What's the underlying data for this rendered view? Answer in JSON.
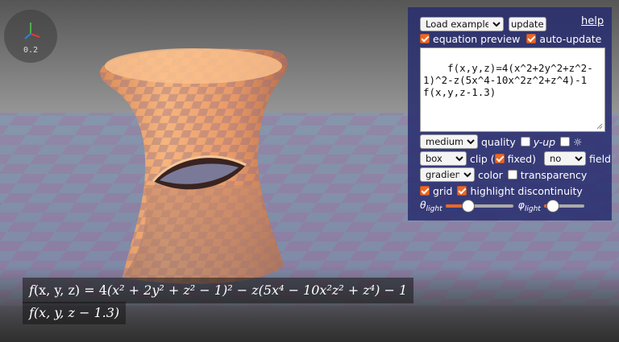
{
  "gizmo": {
    "scale": "0.2"
  },
  "panel": {
    "load_example": {
      "selected": "Load example..."
    },
    "update_label": "update",
    "help_label": "help",
    "equation_preview": {
      "label": "equation preview",
      "checked": true
    },
    "auto_update": {
      "label": "auto-update",
      "checked": true
    },
    "equation": "f(x,y,z)=4(x^2+2y^2+z^2-1)^2-z(5x^4-10x^2z^2+z^4)-1\nf(x,y,z-1.3)",
    "quality": {
      "selected": "medium",
      "label": "quality"
    },
    "y_up": {
      "label": "y-up",
      "checked": false
    },
    "sun": {
      "label": "☼",
      "checked": false
    },
    "clip": {
      "selected": "box",
      "label_before": "clip (",
      "fixed_label": "fixed)",
      "fixed_checked": true
    },
    "field": {
      "selected": "no",
      "label": "field"
    },
    "color": {
      "selected": "gradient",
      "label": "color"
    },
    "transparency": {
      "label": "transparency",
      "checked": false
    },
    "grid": {
      "label": "grid",
      "checked": true
    },
    "highlight": {
      "label": "highlight discontinuity",
      "checked": true
    },
    "theta": {
      "symbol": "θ",
      "sub": "light",
      "value": 0.3
    },
    "phi": {
      "symbol": "φ",
      "sub": "light",
      "value": 0.1
    }
  },
  "formula": {
    "line1_fn": "f",
    "line1_args": "(x, y, z)",
    "line1_eq": " = 4",
    "line1_body": "(x² + 2y² + z² − 1)² − z(5x⁴ − 10x²z² + z⁴) − 1",
    "line2": "f(x, y, z − 1.3)"
  },
  "colors": {
    "accent": "#e8682a",
    "panel": "#28306e",
    "surface": "#f4b07a"
  }
}
